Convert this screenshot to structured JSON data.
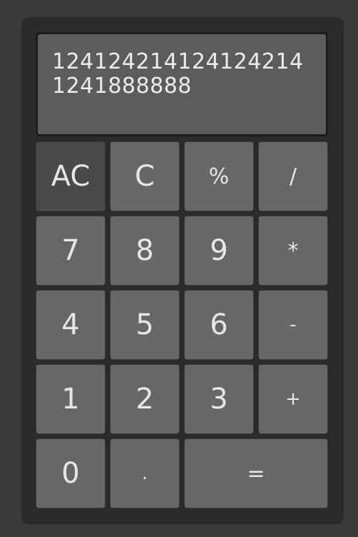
{
  "display": {
    "value": "1241242141241242141241888888"
  },
  "keys": {
    "ac": "AC",
    "c": "C",
    "percent": "%",
    "divide": "/",
    "seven": "7",
    "eight": "8",
    "nine": "9",
    "multiply": "*",
    "four": "4",
    "five": "5",
    "six": "6",
    "minus": "-",
    "one": "1",
    "two": "2",
    "three": "3",
    "plus": "+",
    "zero": "0",
    "decimal": ".",
    "equals": "="
  },
  "colors": {
    "background": "#3a3a3a",
    "body": "#2b2b2b",
    "display": "#5c5c5c",
    "key": "#676767",
    "key_dark": "#4a4a4a",
    "text": "#e6e6e6"
  }
}
